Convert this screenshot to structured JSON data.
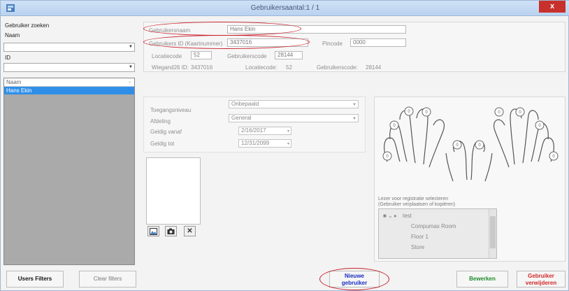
{
  "window": {
    "title": "Gebruikersaantal:1 / 1",
    "close_label": "x"
  },
  "search": {
    "header": "Gebruiker zoeken",
    "name_label": "Naam",
    "id_label": "ID"
  },
  "list": {
    "column_header": "Naam",
    "rows": [
      "Hans Ekin"
    ]
  },
  "info": {
    "username_label": "Gebruikersnaam",
    "username_value": "Hans Ekin",
    "card_label": "Gebruikers ID (Kaartnummer)",
    "card_value": "3437016",
    "pincode_label": "Pincode",
    "pincode_value": "0000",
    "location_label": "Locatiecode",
    "location_value": "52",
    "usercode_label": "Gebruikerscode",
    "usercode_value": "28144",
    "wiegand_label": "Wiegand26 ID:",
    "wiegand_value": "3437016",
    "location2_label": "Locatiecode:",
    "location2_value": "52",
    "usercode2_label": "Gebruikerscode:",
    "usercode2_value": "28144"
  },
  "access": {
    "level_label": "Toegangsniveau",
    "level_value": "Onbepaald",
    "dept_label": "Afdeling",
    "dept_value": "General",
    "valid_from_label": "Geldig vanaf",
    "valid_from_value": "2/16/2017",
    "valid_to_label": "Geldig tot",
    "valid_to_value": "12/31/2099"
  },
  "fingerprint": {
    "finger_count": "0",
    "hint_line1": "Lezer voor registratie selecteren",
    "hint_line2": "(Gebruiker verplaatsen of kopiëren)",
    "tree": [
      "test",
      "Compumax Room",
      "Floor 1",
      "Store"
    ]
  },
  "buttons": {
    "users_filters": "Users Filters",
    "clear_filters": "Clear filters",
    "new_user_l1": "Nieuwe",
    "new_user_l2": "gebruiker",
    "edit": "Bewerken",
    "delete_l1": "Gebruiker",
    "delete_l2": "verwijderen"
  },
  "colors": {
    "accent_blue": "#2f8fe8",
    "annotation_red": "#c8202a",
    "edit_green": "#1f8a2a",
    "delete_red": "#d22a2a",
    "new_blue": "#1a2fc0"
  }
}
